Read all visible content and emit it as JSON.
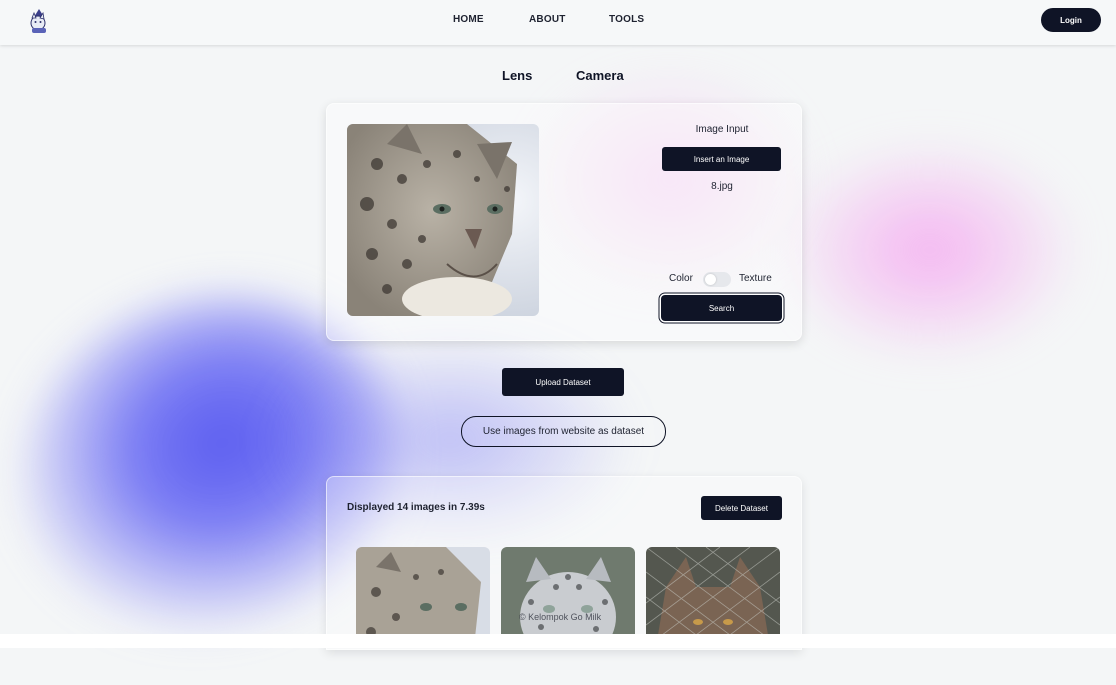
{
  "navbar": {
    "logo_icon": "cat-wizard-logo-icon",
    "links": [
      "HOME",
      "ABOUT",
      "TOOLS"
    ],
    "login_label": "Login"
  },
  "mode_tabs": [
    "Lens",
    "Camera"
  ],
  "query_card": {
    "image_input_label": "Image Input",
    "insert_button": "Insert an Image",
    "filename": "8.jpg",
    "toggle_left": "Color",
    "toggle_right": "Texture",
    "toggle_on": false,
    "search_button": "Search"
  },
  "upload_button": "Upload Dataset",
  "website_dataset_button": "Use images from website as dataset",
  "results": {
    "summary": "Displayed 14 images in 7.39s",
    "delete_button": "Delete Dataset"
  },
  "watermark": "© Kelompok Go Milk",
  "colors": {
    "primary": "#0f1426",
    "background": "#f4f6f7",
    "blob_blue": "#5a5cf0",
    "blob_pink": "#f5a0f0"
  }
}
